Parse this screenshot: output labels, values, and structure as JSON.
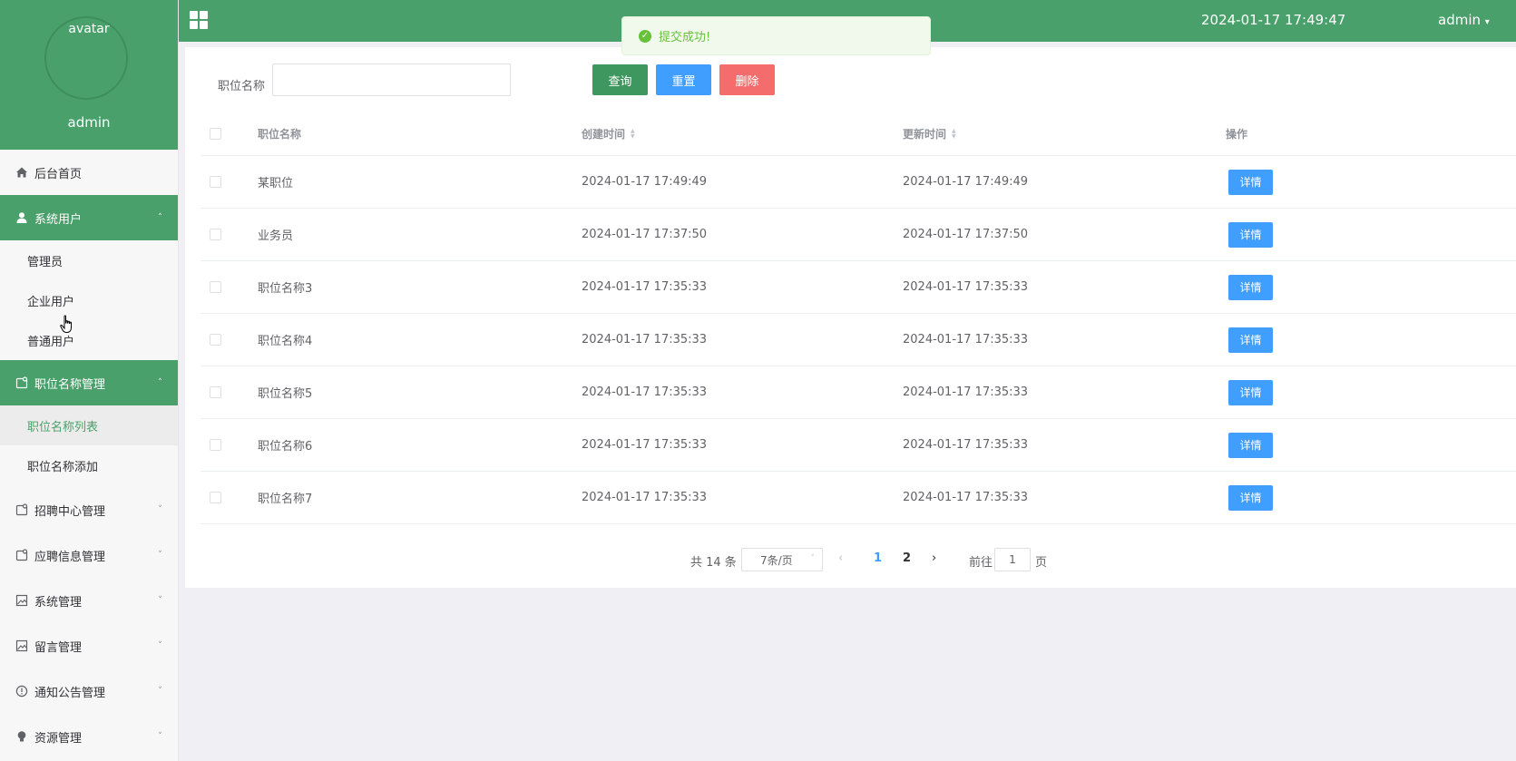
{
  "sidebar": {
    "avatar_alt": "avatar",
    "username": "admin",
    "menu": [
      {
        "label": "后台首页",
        "icon": "home-icon"
      },
      {
        "label": "系统用户",
        "icon": "user-icon"
      },
      {
        "label": "职位名称管理",
        "icon": "folder-icon"
      },
      {
        "label": "招聘中心管理",
        "icon": "folder-icon"
      },
      {
        "label": "应聘信息管理",
        "icon": "folder-icon"
      },
      {
        "label": "系统管理",
        "icon": "image-icon"
      },
      {
        "label": "留言管理",
        "icon": "image-icon"
      },
      {
        "label": "通知公告管理",
        "icon": "info-icon"
      },
      {
        "label": "资源管理",
        "icon": "bulb-icon"
      }
    ],
    "sub_users": [
      "管理员",
      "企业用户",
      "普通用户"
    ],
    "sub_positions": [
      "职位名称列表",
      "职位名称添加"
    ]
  },
  "topbar": {
    "title": "",
    "datetime": "2024-01-17 17:49:47",
    "user": "admin"
  },
  "toast": {
    "message": "提交成功!"
  },
  "search": {
    "label": "职位名称",
    "value": "",
    "query_button": "查询",
    "reset_button": "重置",
    "delete_button": "删除"
  },
  "table": {
    "headers": {
      "name": "职位名称",
      "created": "创建时间",
      "updated": "更新时间",
      "action": "操作"
    },
    "detail_label": "详情",
    "rows": [
      {
        "name": "某职位",
        "created": "2024-01-17 17:49:49",
        "updated": "2024-01-17 17:49:49"
      },
      {
        "name": "业务员",
        "created": "2024-01-17 17:37:50",
        "updated": "2024-01-17 17:37:50"
      },
      {
        "name": "职位名称3",
        "created": "2024-01-17 17:35:33",
        "updated": "2024-01-17 17:35:33"
      },
      {
        "name": "职位名称4",
        "created": "2024-01-17 17:35:33",
        "updated": "2024-01-17 17:35:33"
      },
      {
        "name": "职位名称5",
        "created": "2024-01-17 17:35:33",
        "updated": "2024-01-17 17:35:33"
      },
      {
        "name": "职位名称6",
        "created": "2024-01-17 17:35:33",
        "updated": "2024-01-17 17:35:33"
      },
      {
        "name": "职位名称7",
        "created": "2024-01-17 17:35:33",
        "updated": "2024-01-17 17:35:33"
      }
    ]
  },
  "pagination": {
    "total": "共 14 条",
    "page_size": "7条/页",
    "pages": [
      "1",
      "2"
    ],
    "current_page": "1",
    "goto_label": "前往",
    "goto_value": "1",
    "page_suffix": "页"
  },
  "colors": {
    "brand_green": "#4aa06b",
    "primary_blue": "#409eff",
    "danger_red": "#f56c6c",
    "success_green": "#67c23a"
  }
}
